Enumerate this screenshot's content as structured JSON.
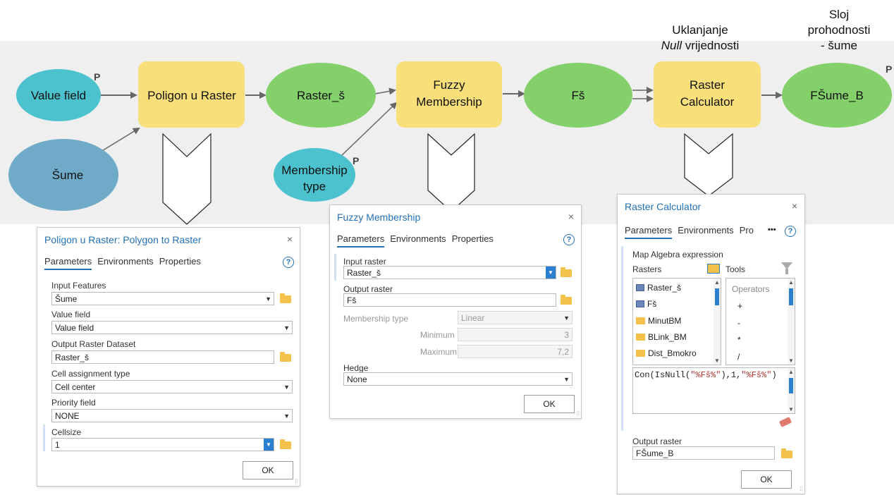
{
  "nodes": {
    "value_field": "Value field",
    "sume": "Šume",
    "poligon_u_raster": "Poligon u Raster",
    "raster_s": "Raster_š",
    "fuzzy_line1": "Fuzzy",
    "fuzzy_line2": "Membership",
    "membership_line1": "Membership",
    "membership_line2": "type",
    "fs": "Fš",
    "raster_calc_line1": "Raster",
    "raster_calc_line2": "Calculator",
    "fsume_b": "FŠume_B",
    "p_marker": "P"
  },
  "captions": {
    "null_line1": "Uklanjanje",
    "null_italic": "Null",
    "null_rest": " vrijednosti",
    "sloj_line1": "Sloj",
    "sloj_line2": "prohodnosti",
    "sloj_line3": "- šume"
  },
  "colors": {
    "teal_node": "#4cc2cf",
    "blue_node": "#6faac9",
    "yellow_node": "#f8df7a",
    "green_node": "#84d06b",
    "accent": "#2370b6"
  },
  "dialog_polygon": {
    "title": "Poligon u Raster: Polygon to Raster",
    "close": "×",
    "tabs": [
      "Parameters",
      "Environments",
      "Properties"
    ],
    "help": "?",
    "input_features_label": "Input Features",
    "input_features_value": "Šume",
    "value_field_label": "Value field",
    "value_field_value": "Value field",
    "output_label": "Output Raster Dataset",
    "output_value": "Raster_š",
    "cell_assign_label": "Cell assignment type",
    "cell_assign_value": "Cell center",
    "priority_label": "Priority field",
    "priority_value": "NONE",
    "cellsize_label": "Cellsize",
    "cellsize_value": "1",
    "ok": "OK"
  },
  "dialog_fuzzy": {
    "title": "Fuzzy Membership",
    "close": "×",
    "tabs": [
      "Parameters",
      "Environments",
      "Properties"
    ],
    "help": "?",
    "input_label": "Input raster",
    "input_value": "Raster_š",
    "output_label": "Output raster",
    "output_value": "Fš",
    "membership_label": "Membership type",
    "membership_value": "Linear",
    "minimum_label": "Minimum",
    "minimum_value": "3",
    "maximum_label": "Maximum",
    "maximum_value": "7,2",
    "hedge_label": "Hedge",
    "hedge_value": "None",
    "ok": "OK"
  },
  "dialog_calc": {
    "title": "Raster Calculator",
    "close": "×",
    "tabs": [
      "Parameters",
      "Environments",
      "Pro"
    ],
    "more": "•••",
    "help": "?",
    "expression_label": "Map Algebra expression",
    "rasters_label": "Rasters",
    "tools_label": "Tools",
    "rasters": [
      "Raster_š",
      "Fš",
      "MinutBM",
      "BLink_BM",
      "Dist_Bmokro"
    ],
    "operators_label": "Operators",
    "operators": [
      "+",
      "-",
      "*",
      "/"
    ],
    "expr_prefix": "Con(IsNull(",
    "expr_q1": "\"%Fš%\"",
    "expr_mid": "),1,",
    "expr_q2": "\"%Fš%\"",
    "expr_suffix": ")",
    "output_label": "Output raster",
    "output_value": "FŠume_B",
    "ok": "OK"
  }
}
